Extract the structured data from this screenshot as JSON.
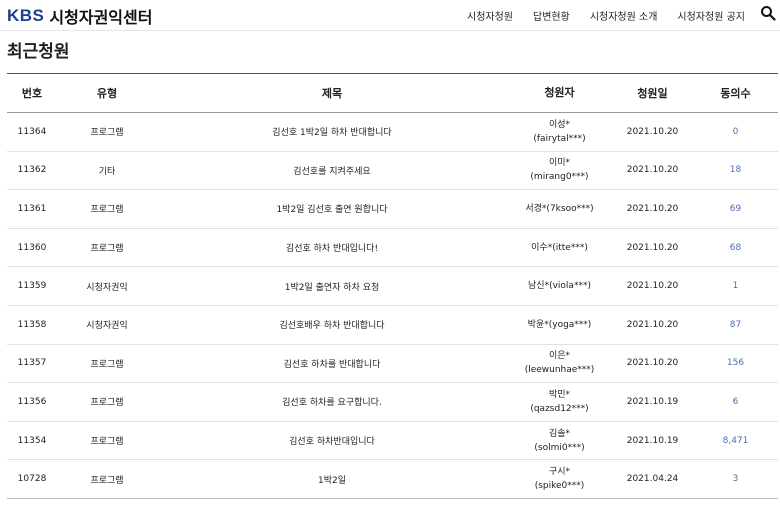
{
  "header": {
    "logo_brand": "KBS",
    "logo_title": "시청자권익센터",
    "nav": [
      "시청자청원",
      "답변현황",
      "시청자청원 소개",
      "시청자청원 공지"
    ]
  },
  "page_title": "최근청원",
  "table": {
    "headers": {
      "no": "번호",
      "type": "유형",
      "title": "제목",
      "author": "청원자",
      "date": "청원일",
      "agree": "동의수"
    },
    "rows": [
      {
        "no": "11364",
        "type": "프로그램",
        "title": "김선호 1박2일 하차 반대합니다",
        "author_1": "이성*",
        "author_2": "(fairytal***)",
        "date": "2021.10.20",
        "agree": "0"
      },
      {
        "no": "11362",
        "type": "기타",
        "title": "김선호를 지켜주세요",
        "author_1": "이미*",
        "author_2": "(mirang0***)",
        "date": "2021.10.20",
        "agree": "18"
      },
      {
        "no": "11361",
        "type": "프로그램",
        "title": "1박2일 김선호 출연 원합니다",
        "author_1": "서경*(7ksoo***)",
        "author_2": "",
        "date": "2021.10.20",
        "agree": "69"
      },
      {
        "no": "11360",
        "type": "프로그램",
        "title": "김선호 하차 반대입니다!",
        "author_1": "이수*(itte***)",
        "author_2": "",
        "date": "2021.10.20",
        "agree": "68"
      },
      {
        "no": "11359",
        "type": "시청자권익",
        "title": "1박2일 출연자 하차 요청",
        "author_1": "남신*(viola***)",
        "author_2": "",
        "date": "2021.10.20",
        "agree": "1"
      },
      {
        "no": "11358",
        "type": "시청자권익",
        "title": "김선호배우 하차 반대합니다",
        "author_1": "박윤*(yoga***)",
        "author_2": "",
        "date": "2021.10.20",
        "agree": "87"
      },
      {
        "no": "11357",
        "type": "프로그램",
        "title": "김선호 하차를 반대합니다",
        "author_1": "이은*",
        "author_2": "(leewunhae***)",
        "date": "2021.10.20",
        "agree": "156"
      },
      {
        "no": "11356",
        "type": "프로그램",
        "title": "김선호 하차를 요구합니다.",
        "author_1": "박민*",
        "author_2": "(qazsd12***)",
        "date": "2021.10.19",
        "agree": "6"
      },
      {
        "no": "11354",
        "type": "프로그램",
        "title": "김선호 하차반대입니다",
        "author_1": "김솔*",
        "author_2": "(solmi0***)",
        "date": "2021.10.19",
        "agree": "8,471"
      },
      {
        "no": "10728",
        "type": "프로그램",
        "title": "1박2일",
        "author_1": "구시*",
        "author_2": "(spike0***)",
        "date": "2021.04.24",
        "agree": "3"
      }
    ]
  }
}
